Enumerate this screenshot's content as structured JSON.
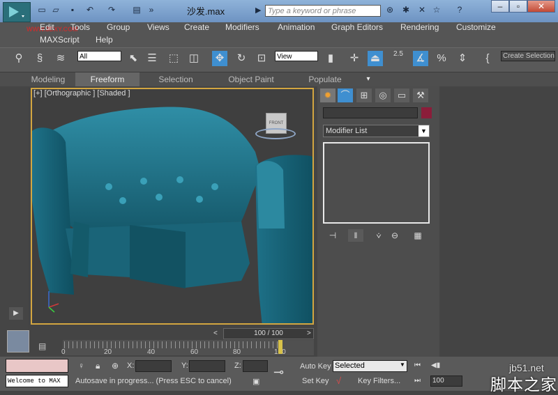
{
  "titlebar": {
    "document_title": "沙发.max",
    "search_placeholder": "Type a keyword or phrase",
    "watermark": "WWW.3DXY.COM"
  },
  "menu": [
    "Edit",
    "Tools",
    "Group",
    "Views",
    "Create",
    "Modifiers",
    "Animation",
    "Graph Editors",
    "Rendering",
    "Customize",
    "MAXScript",
    "Help"
  ],
  "toolbar": {
    "selection_filter": "All",
    "reference_coord": "View",
    "snap_value": "2.5",
    "create_selection_set": "Create Selection"
  },
  "ribbon": {
    "tabs": [
      "Modeling",
      "Freeform",
      "Selection",
      "Object Paint",
      "Populate"
    ],
    "active": "Freeform"
  },
  "viewport": {
    "label": "[+] [Orthographic ] [Shaded ]",
    "viewcube_label": "FRONT"
  },
  "command_panel": {
    "modifier_list": "Modifier List",
    "object_color": "#8b1d3a"
  },
  "timeline": {
    "slider": "100 / 100",
    "ticks": [
      "0",
      "20",
      "40",
      "60",
      "80",
      "100"
    ]
  },
  "status": {
    "coord_labels": [
      "X:",
      "Y:",
      "Z:"
    ],
    "maxscript_text": "Welcome to MAX",
    "prompt": "Autosave in progress... (Press ESC to cancel)",
    "auto_key": "Auto Key",
    "set_key": "Set Key",
    "selected": "Selected",
    "key_filters": "Key Filters...",
    "current_frame": "100"
  },
  "watermarks": {
    "site": "jb51.net",
    "site_cn": "脚本之家"
  },
  "colors": {
    "accent_border": "#d3a640",
    "sofa": "#1a6f86"
  }
}
